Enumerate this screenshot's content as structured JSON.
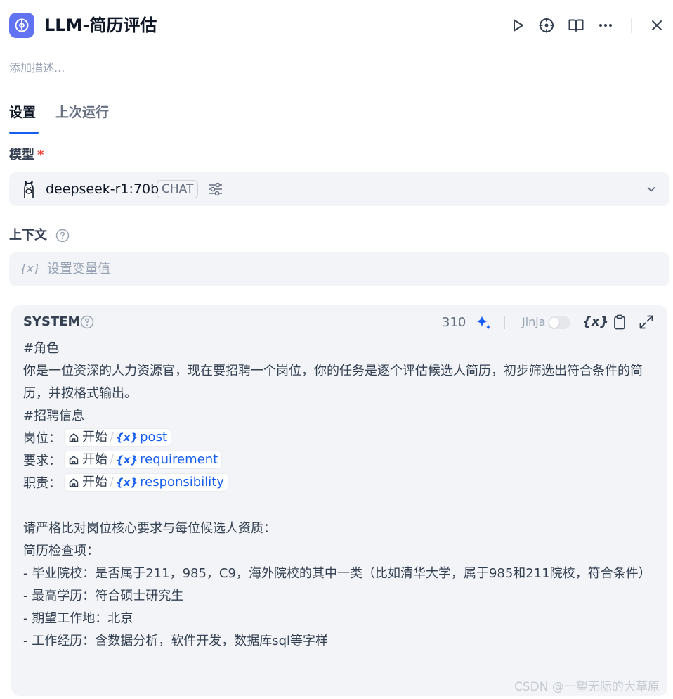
{
  "header": {
    "title": "LLM-简历评估",
    "icons": [
      "play-icon",
      "crosshair-icon",
      "book-open-icon",
      "more-icon",
      "close-icon"
    ]
  },
  "description": {
    "placeholder": "添加描述..."
  },
  "tabs": [
    {
      "label": "设置",
      "active": true
    },
    {
      "label": "上次运行",
      "active": false
    }
  ],
  "model": {
    "label": "模型",
    "required_mark": "*",
    "name": "deepseek-r1:70b",
    "mode": "CHAT"
  },
  "context": {
    "label": "上下文",
    "var_icon": "{x}",
    "placeholder": "设置变量值"
  },
  "system": {
    "title": "SYSTEM",
    "count": "310",
    "jinja_label": "Jinja",
    "jinja_enabled": false,
    "var_button": "{x}",
    "prompt": {
      "line1": "#角色",
      "line2": "你是一位资深的人力资源官，现在要招聘一个岗位，你的任务是逐个评估候选人简历，初步筛选出符合条件的简历，并按格式输出。",
      "line3": "#招聘信息",
      "vars": [
        {
          "label": "岗位：",
          "node": "开始",
          "slash": "/",
          "x": "{x}",
          "var": "post"
        },
        {
          "label": "要求：",
          "node": "开始",
          "slash": "/",
          "x": "{x}",
          "var": "requirement"
        },
        {
          "label": "职责：",
          "node": "开始",
          "slash": "/",
          "x": "{x}",
          "var": "responsibility"
        }
      ],
      "line4": "请严格比对岗位核心要求与每位候选人资质：",
      "line5": "简历检查项：",
      "line6": "- 毕业院校：是否属于211，985，C9，海外院校的其中一类（比如清华大学，属于985和211院校，符合条件）",
      "line7": "- 最高学历：符合硕士研究生",
      "line8": "- 期望工作地：北京",
      "line9": "- 工作经历：含数据分析，软件开发，数据库sql等字样"
    }
  },
  "watermark": "CSDN @一望无际的大草原",
  "colors": {
    "accent": "#155eef",
    "app_icon_bg": "#6172f3",
    "required": "#f04438"
  }
}
